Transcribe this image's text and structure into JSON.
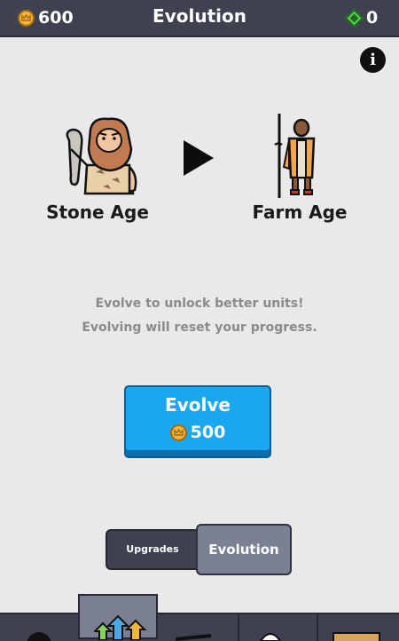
{
  "header": {
    "coins": "600",
    "title": "Evolution",
    "gems": "0"
  },
  "evolution": {
    "current_age": "Stone Age",
    "next_age": "Farm Age",
    "description_line1": "Evolve to unlock better units!",
    "description_line2": "Evolving will reset your progress."
  },
  "evolve_button": {
    "label": "Evolve",
    "cost": "500"
  },
  "tabs": {
    "upgrades": "Upgrades",
    "evolution": "Evolution",
    "active": "Evolution"
  },
  "bottom_nav": {
    "items": [
      "account-icon",
      "upgrade-arrows-icon",
      "sword-icon",
      "shield-icon",
      "chest-icon"
    ],
    "active_index": 1
  },
  "icons": {
    "coin": "crown-coin-icon",
    "gem": "green-gem-icon",
    "info": "info-icon"
  },
  "colors": {
    "topbar": "#3e4150",
    "background": "#e9e9e9",
    "evolve_button": "#19a7ef",
    "coin": "#f3b53a",
    "gem": "#5ed052"
  }
}
